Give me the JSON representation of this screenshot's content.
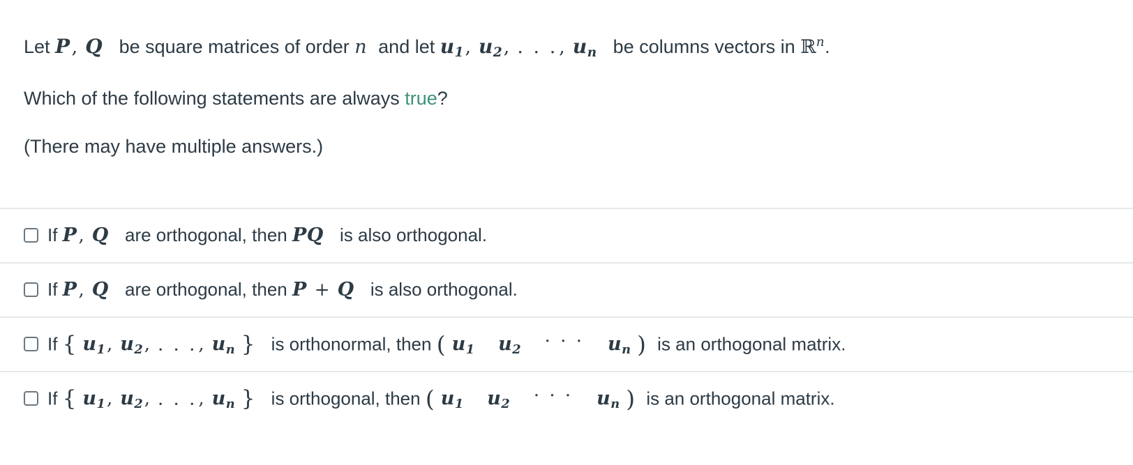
{
  "question": {
    "stem_lines": [
      {
        "id": "stem-1",
        "parts": [
          {
            "type": "text",
            "value": "Let "
          },
          {
            "type": "math",
            "value": "P, Q"
          },
          {
            "type": "text",
            "value": " be square matrices of order "
          },
          {
            "type": "math",
            "value": "n"
          },
          {
            "type": "text",
            "value": " and let "
          },
          {
            "type": "math",
            "value": "u1, u2, ..., un"
          },
          {
            "type": "text",
            "value": " be columns vectors in "
          },
          {
            "type": "math",
            "value": "R^n"
          },
          {
            "type": "text",
            "value": "."
          }
        ],
        "plain": "Let P, Q be square matrices of order n and let u1, u2, ..., un be columns vectors in R^n."
      },
      {
        "id": "stem-2",
        "plain": "Which of the following statements are always true?",
        "lead": "Which of the following statements are always ",
        "highlight": "true",
        "tail": "?"
      },
      {
        "id": "stem-3",
        "plain": "(There may have multiple answers.)"
      }
    ]
  },
  "answers": [
    {
      "id": "answer-1",
      "checked": false,
      "lead": "If ",
      "math1": "P, Q",
      "mid": " are orthogonal, then ",
      "math2": "PQ",
      "tail": " is also orthogonal.",
      "plain": "If P, Q are orthogonal, then PQ is also orthogonal."
    },
    {
      "id": "answer-2",
      "checked": false,
      "lead": "If ",
      "math1": "P, Q",
      "mid": " are orthogonal, then ",
      "math2": "P + Q",
      "tail": " is also orthogonal.",
      "plain": "If P, Q are orthogonal, then P + Q is also orthogonal."
    },
    {
      "id": "answer-3",
      "checked": false,
      "lead": "If ",
      "math1": "{ u1, u2, ..., un }",
      "mid": " is orthonormal,  then ",
      "math2": "( u1  u2  ...  un )",
      "tail": " is an orthogonal matrix.",
      "plain": "If { u1, u2, ..., un } is orthonormal, then ( u1 u2 ... un ) is an orthogonal matrix."
    },
    {
      "id": "answer-4",
      "checked": false,
      "lead": "If ",
      "math1": "{ u1, u2, ..., un }",
      "mid": " is orthogonal,  then ",
      "math2": "( u1  u2  ...  un )",
      "tail": " is an orthogonal matrix.",
      "plain": "If { u1, u2, ..., un } is orthogonal, then ( u1 u2 ... un ) is an orthogonal matrix."
    }
  ],
  "symbols": {
    "P": "P",
    "Q": "Q",
    "n": "n",
    "u": "u",
    "comma": ",",
    "ldots": ". . .",
    "cdots": "· · ·",
    "plus": "+",
    "blackboard_R": "ℝ",
    "lbrace": "{",
    "rbrace": "}",
    "lparen": "(",
    "rparen": ")",
    "sub1": "1",
    "sub2": "2",
    "subn": "n",
    "supn": "n"
  },
  "colors": {
    "text": "#2d3b45",
    "accent_true": "#3d9279",
    "divider": "#e6e8e9",
    "checkbox_border": "#6b7780",
    "background": "#ffffff"
  },
  "words": {
    "let": "Let ",
    "be_square": " be square matrices of order ",
    "and_let": " and let ",
    "be_columns": " be columns vectors in ",
    "period": ".",
    "which_lead": "Which of the following statements are always ",
    "which_tail": "?",
    "true": "true",
    "multiple": "(There may have multiple answers.)"
  }
}
